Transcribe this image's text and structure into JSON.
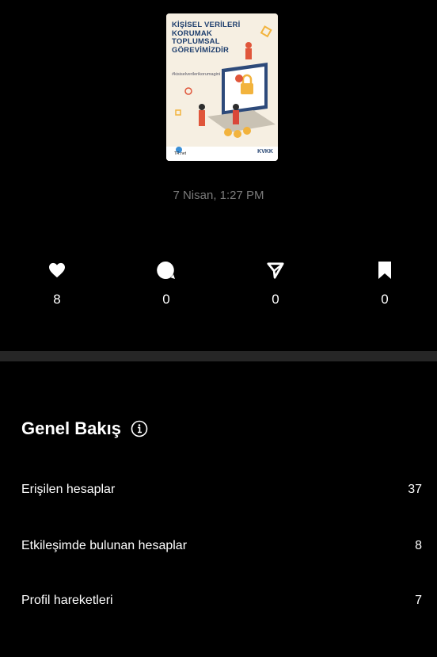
{
  "post": {
    "thumbnail": {
      "title": "KİŞİSEL VERİLERİ KORUMAK TOPLUMSAL GÖREVİMİZDİR",
      "hashtag": "#kisiselverilerikorumagini",
      "footer_left": "TR.net",
      "footer_right": "KVKK"
    },
    "timestamp": "7 Nisan, 1:27 PM"
  },
  "stats": {
    "likes": {
      "icon": "heart-icon",
      "value": "8"
    },
    "comments": {
      "icon": "comment-icon",
      "value": "0"
    },
    "shares": {
      "icon": "send-icon",
      "value": "0"
    },
    "saves": {
      "icon": "bookmark-icon",
      "value": "0"
    }
  },
  "overview": {
    "title": "Genel Bakış",
    "info_icon": "info-icon",
    "rows": [
      {
        "label": "Erişilen hesaplar",
        "value": "37"
      },
      {
        "label": "Etkileşimde bulunan hesaplar",
        "value": "8"
      },
      {
        "label": "Profil hareketleri",
        "value": "7"
      }
    ]
  },
  "colors": {
    "background": "#000000",
    "divider": "#262626",
    "muted_text": "#7a7a7a",
    "text": "#ffffff"
  }
}
